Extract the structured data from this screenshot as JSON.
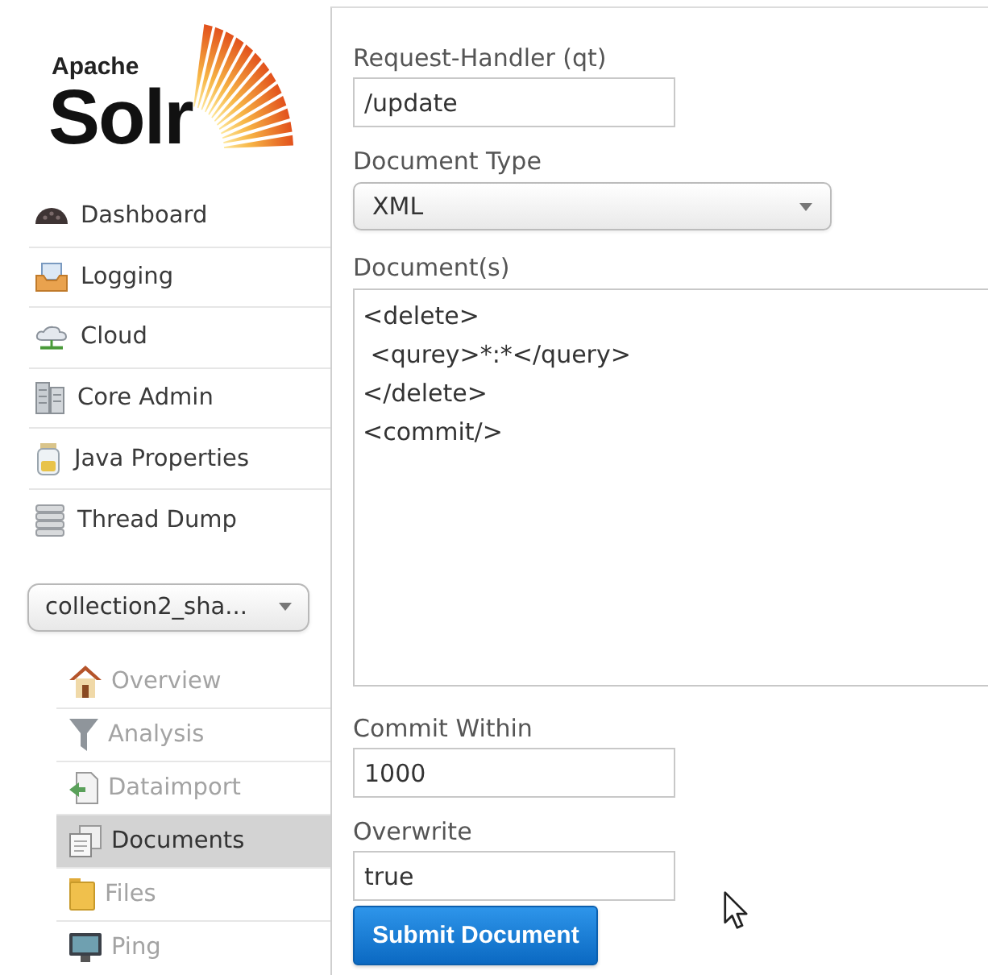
{
  "logo": {
    "small_text": "Apache",
    "large_text": "Solr"
  },
  "nav": {
    "items": [
      {
        "label": "Dashboard",
        "selected": false
      },
      {
        "label": "Logging",
        "selected": false
      },
      {
        "label": "Cloud",
        "selected": false
      },
      {
        "label": "Core Admin",
        "selected": false
      },
      {
        "label": "Java Properties",
        "selected": false
      },
      {
        "label": "Thread Dump",
        "selected": false
      }
    ]
  },
  "core_selector": {
    "value": "collection2_sha..."
  },
  "core_menu": {
    "items": [
      {
        "label": "Overview",
        "selected": false
      },
      {
        "label": "Analysis",
        "selected": false
      },
      {
        "label": "Dataimport",
        "selected": false
      },
      {
        "label": "Documents",
        "selected": true
      },
      {
        "label": "Files",
        "selected": false
      },
      {
        "label": "Ping",
        "selected": false
      }
    ]
  },
  "form": {
    "fields": [
      {
        "kind": "text",
        "label": "Request-Handler (qt)",
        "value": "/update"
      },
      {
        "kind": "select",
        "label": "Document Type",
        "value": "XML"
      },
      {
        "kind": "textarea",
        "label": "Document(s)",
        "value": "<delete>\n <qurey>*:*</query>\n</delete>\n<commit/>"
      },
      {
        "kind": "text",
        "label": "Commit Within",
        "value": "1000"
      },
      {
        "kind": "text",
        "label": "Overwrite",
        "value": "true"
      }
    ],
    "submit_button": "Submit Document"
  }
}
